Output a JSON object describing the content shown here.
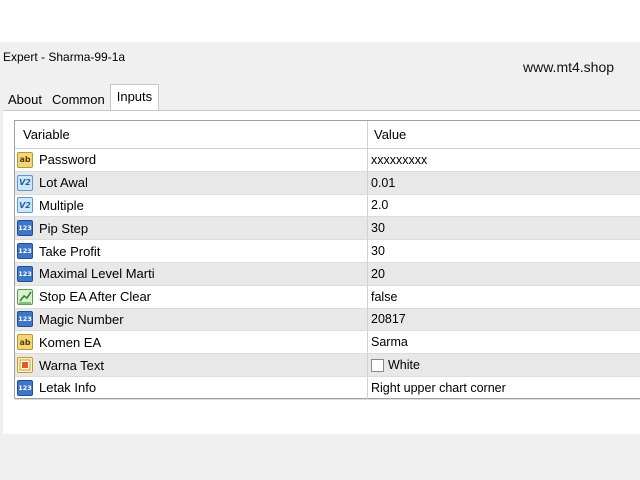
{
  "window": {
    "title": "Expert - Sharma-99-1a"
  },
  "watermark": "www.mt4.shop",
  "tabs": [
    {
      "label": "About",
      "active": false
    },
    {
      "label": "Common",
      "active": false
    },
    {
      "label": "Inputs",
      "active": true
    }
  ],
  "table": {
    "headers": {
      "variable": "Variable",
      "value": "Value"
    },
    "rows": [
      {
        "icon": "string-ab-icon",
        "variable": "Password",
        "value": "xxxxxxxxx"
      },
      {
        "icon": "double-v2-icon",
        "variable": "Lot Awal",
        "value": "0.01"
      },
      {
        "icon": "double-v2-icon",
        "variable": "Multiple",
        "value": "2.0"
      },
      {
        "icon": "integer-123-icon",
        "variable": "Pip Step",
        "value": "30"
      },
      {
        "icon": "integer-123-icon",
        "variable": "Take Profit",
        "value": "30"
      },
      {
        "icon": "integer-123-icon",
        "variable": "Maximal Level Marti",
        "value": "20"
      },
      {
        "icon": "bool-icon",
        "variable": "Stop EA After Clear",
        "value": "false"
      },
      {
        "icon": "integer-123-icon",
        "variable": "Magic Number",
        "value": "20817"
      },
      {
        "icon": "string-ab-icon",
        "variable": "Komen EA",
        "value": "Sarma"
      },
      {
        "icon": "color-icon",
        "variable": "Warna Text",
        "value": "White",
        "swatch": "#ffffff"
      },
      {
        "icon": "integer-123-icon",
        "variable": "Letak Info",
        "value": "Right upper chart corner"
      }
    ]
  }
}
